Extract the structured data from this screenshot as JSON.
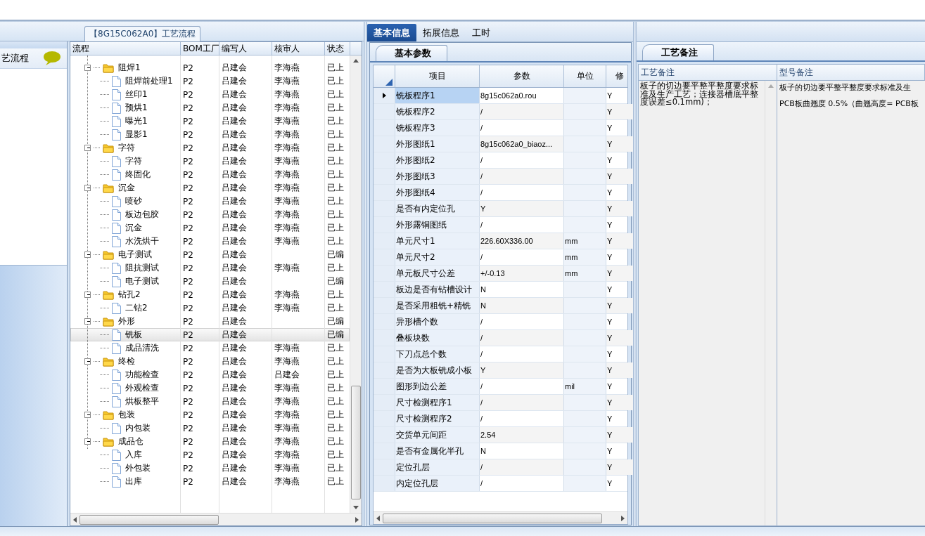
{
  "left_panel": {
    "title": "【8G15C062A0】工艺流程",
    "sidebar": {
      "items": [
        {
          "label": "艺流程",
          "selected": true
        }
      ]
    }
  },
  "tree": {
    "columns": [
      "流程",
      "BOM工厂",
      "编写人",
      "核审人",
      "状态"
    ],
    "nodes": [
      {
        "name": "阻焊1",
        "bom": "P2",
        "author": "吕建会",
        "reviewer": "李海燕",
        "status": "已上",
        "selected": false,
        "expanded": true,
        "children": [
          {
            "name": "阻焊前处理1",
            "bom": "P2",
            "author": "吕建会",
            "reviewer": "李海燕",
            "status": "已上",
            "selected": false
          },
          {
            "name": "丝印1",
            "bom": "P2",
            "author": "吕建会",
            "reviewer": "李海燕",
            "status": "已上",
            "selected": false
          },
          {
            "name": "预烘1",
            "bom": "P2",
            "author": "吕建会",
            "reviewer": "李海燕",
            "status": "已上",
            "selected": false
          },
          {
            "name": "曝光1",
            "bom": "P2",
            "author": "吕建会",
            "reviewer": "李海燕",
            "status": "已上",
            "selected": false
          },
          {
            "name": "显影1",
            "bom": "P2",
            "author": "吕建会",
            "reviewer": "李海燕",
            "status": "已上",
            "selected": false
          }
        ]
      },
      {
        "name": "字符",
        "bom": "P2",
        "author": "吕建会",
        "reviewer": "李海燕",
        "status": "已上",
        "selected": false,
        "expanded": true,
        "children": [
          {
            "name": "字符",
            "bom": "P2",
            "author": "吕建会",
            "reviewer": "李海燕",
            "status": "已上",
            "selected": false
          },
          {
            "name": "终固化",
            "bom": "P2",
            "author": "吕建会",
            "reviewer": "李海燕",
            "status": "已上",
            "selected": false
          }
        ]
      },
      {
        "name": "沉金",
        "bom": "P2",
        "author": "吕建会",
        "reviewer": "李海燕",
        "status": "已上",
        "selected": false,
        "expanded": true,
        "children": [
          {
            "name": "喷砂",
            "bom": "P2",
            "author": "吕建会",
            "reviewer": "李海燕",
            "status": "已上",
            "selected": false
          },
          {
            "name": "板边包胶",
            "bom": "P2",
            "author": "吕建会",
            "reviewer": "李海燕",
            "status": "已上",
            "selected": false
          },
          {
            "name": "沉金",
            "bom": "P2",
            "author": "吕建会",
            "reviewer": "李海燕",
            "status": "已上",
            "selected": false
          },
          {
            "name": "水洗烘干",
            "bom": "P2",
            "author": "吕建会",
            "reviewer": "李海燕",
            "status": "已上",
            "selected": false
          }
        ]
      },
      {
        "name": "电子测试",
        "bom": "P2",
        "author": "吕建会",
        "status": "已编",
        "selected": false,
        "expanded": true,
        "children": [
          {
            "name": "阻抗测试",
            "bom": "P2",
            "author": "吕建会",
            "reviewer": "李海燕",
            "status": "已上",
            "selected": false
          },
          {
            "name": "电子测试",
            "bom": "P2",
            "author": "吕建会",
            "status": "已编",
            "selected": false
          }
        ]
      },
      {
        "name": "钻孔2",
        "bom": "P2",
        "author": "吕建会",
        "reviewer": "李海燕",
        "status": "已上",
        "selected": false,
        "expanded": true,
        "children": [
          {
            "name": "二钻2",
            "bom": "P2",
            "author": "吕建会",
            "reviewer": "李海燕",
            "status": "已上",
            "selected": false
          }
        ]
      },
      {
        "name": "外形",
        "bom": "P2",
        "author": "吕建会",
        "status": "已编",
        "selected": false,
        "expanded": true,
        "children": [
          {
            "name": "铣板",
            "bom": "P2",
            "author": "吕建会",
            "status": "已编",
            "selected": true
          },
          {
            "name": "成品清洗",
            "bom": "P2",
            "author": "吕建会",
            "reviewer": "李海燕",
            "status": "已上",
            "selected": false
          }
        ]
      },
      {
        "name": "终检",
        "bom": "P2",
        "author": "吕建会",
        "reviewer": "李海燕",
        "status": "已上",
        "selected": false,
        "expanded": true,
        "children": [
          {
            "name": "功能检查",
            "bom": "P2",
            "author": "吕建会",
            "reviewer": "吕建会",
            "status": "已上",
            "selected": false
          },
          {
            "name": "外观检查",
            "bom": "P2",
            "author": "吕建会",
            "reviewer": "李海燕",
            "status": "已上",
            "selected": false
          },
          {
            "name": "烘板整平",
            "bom": "P2",
            "author": "吕建会",
            "reviewer": "李海燕",
            "status": "已上",
            "selected": false
          }
        ]
      },
      {
        "name": "包装",
        "bom": "P2",
        "author": "吕建会",
        "reviewer": "李海燕",
        "status": "已上",
        "selected": false,
        "expanded": true,
        "children": [
          {
            "name": "内包装",
            "bom": "P2",
            "author": "吕建会",
            "reviewer": "李海燕",
            "status": "已上",
            "selected": false
          }
        ]
      },
      {
        "name": "成品仓",
        "bom": "P2",
        "author": "吕建会",
        "reviewer": "李海燕",
        "status": "已上",
        "selected": false,
        "expanded": true,
        "children": [
          {
            "name": "入库",
            "bom": "P2",
            "author": "吕建会",
            "reviewer": "李海燕",
            "status": "已上",
            "selected": false
          },
          {
            "name": "外包装",
            "bom": "P2",
            "author": "吕建会",
            "reviewer": "李海燕",
            "status": "已上",
            "selected": false
          },
          {
            "name": "出库",
            "bom": "P2",
            "author": "吕建会",
            "reviewer": "李海燕",
            "status": "已上",
            "selected": false
          }
        ]
      }
    ]
  },
  "tabs": [
    {
      "label": "基本信息",
      "selected": true
    },
    {
      "label": "拓展信息",
      "selected": false
    },
    {
      "label": "工时",
      "selected": false
    }
  ],
  "params": {
    "section_tab": "基本参数",
    "columns": [
      "项目",
      "参数",
      "单位",
      "修"
    ],
    "rows": [
      {
        "item": "铣板程序1",
        "value": "8g15c062a0.rou",
        "modified": "Y",
        "selected": true
      },
      {
        "item": "铣板程序2",
        "value": "/",
        "modified": "Y",
        "selected": false
      },
      {
        "item": "铣板程序3",
        "value": "/",
        "modified": "Y",
        "selected": false
      },
      {
        "item": "外形图纸1",
        "value": "8g15c062a0_biaoz...",
        "modified": "Y",
        "selected": false
      },
      {
        "item": "外形图纸2",
        "value": "/",
        "modified": "Y",
        "selected": false
      },
      {
        "item": "外形图纸3",
        "value": "/",
        "modified": "Y",
        "selected": false
      },
      {
        "item": "外形图纸4",
        "value": "/",
        "modified": "Y",
        "selected": false
      },
      {
        "item": "是否有内定位孔",
        "value": "Y",
        "modified": "Y",
        "selected": false
      },
      {
        "item": "外形露铜图纸",
        "value": "/",
        "modified": "Y",
        "selected": false
      },
      {
        "item": "单元尺寸1",
        "value": "226.60X336.00",
        "unit": "mm",
        "modified": "Y",
        "selected": false
      },
      {
        "item": "单元尺寸2",
        "value": "/",
        "unit": "mm",
        "modified": "Y",
        "selected": false
      },
      {
        "item": "单元板尺寸公差",
        "value": "+/-0.13",
        "unit": "mm",
        "modified": "Y",
        "selected": false
      },
      {
        "item": "板边是否有钻槽设计",
        "value": "N",
        "modified": "Y",
        "selected": false
      },
      {
        "item": "是否采用粗铣+精铣",
        "value": "N",
        "modified": "Y",
        "selected": false
      },
      {
        "item": "异形槽个数",
        "value": "/",
        "modified": "Y",
        "selected": false
      },
      {
        "item": "叠板块数",
        "value": "/",
        "modified": "Y",
        "selected": false
      },
      {
        "item": "下刀点总个数",
        "value": "/",
        "modified": "Y",
        "selected": false
      },
      {
        "item": "是否为大板铣成小板",
        "value": "Y",
        "modified": "Y",
        "selected": false
      },
      {
        "item": "图形到边公差",
        "value": "/",
        "unit": "mil",
        "modified": "Y",
        "selected": false
      },
      {
        "item": "尺寸检测程序1",
        "value": "/",
        "modified": "Y",
        "selected": false
      },
      {
        "item": "尺寸检测程序2",
        "value": "/",
        "modified": "Y",
        "selected": false
      },
      {
        "item": "交货单元间距",
        "value": "2.54",
        "modified": "Y",
        "selected": false
      },
      {
        "item": "是否有金属化半孔",
        "value": "N",
        "modified": "Y",
        "selected": false
      },
      {
        "item": "定位孔层",
        "value": "/",
        "modified": "Y",
        "selected": false
      },
      {
        "item": "内定位孔层",
        "value": "/",
        "modified": "Y",
        "selected": false
      }
    ]
  },
  "notes": {
    "section_tab": "工艺备注",
    "columns": [
      "工艺备注",
      "型号备注"
    ],
    "process_note": "板子的切边要平整平整度要求标准及生产工艺；连接器槽底平整度误差≤0.1mm)；",
    "model_note_lines": [
      "板子的切边要平整平整度要求标准及生",
      "PCB板曲翘度 0.5%（曲翘高度= PCB板"
    ]
  }
}
